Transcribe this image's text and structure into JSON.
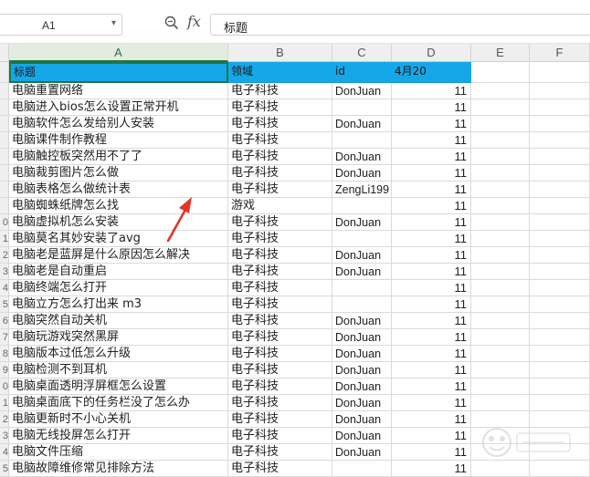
{
  "formula_bar": {
    "cell_ref": "A1",
    "fx": "fx",
    "formula_text": "标题"
  },
  "columns": [
    "A",
    "B",
    "C",
    "D",
    "E",
    "F"
  ],
  "header_row": {
    "title": "标题",
    "field": "领域",
    "id": "id",
    "date": "4月20"
  },
  "rows": [
    {
      "n": "",
      "title": "电脑重置网络",
      "field": "电子科技",
      "id": "DonJuan",
      "count": "11"
    },
    {
      "n": "",
      "title": "电脑进入bios怎么设置正常开机",
      "field": "电子科技",
      "id": "",
      "count": "11"
    },
    {
      "n": "",
      "title": "电脑软件怎么发给别人安装",
      "field": "电子科技",
      "id": "DonJuan",
      "count": "11"
    },
    {
      "n": "",
      "title": "电脑课件制作教程",
      "field": "电子科技",
      "id": "",
      "count": "11"
    },
    {
      "n": "",
      "title": "电脑触控板突然用不了了",
      "field": "电子科技",
      "id": "DonJuan",
      "count": "11"
    },
    {
      "n": "",
      "title": "电脑裁剪图片怎么做",
      "field": "电子科技",
      "id": "DonJuan",
      "count": "11"
    },
    {
      "n": "",
      "title": "电脑表格怎么做统计表",
      "field": "电子科技",
      "id": "ZengLi199",
      "count": "11"
    },
    {
      "n": "",
      "title": "电脑蜘蛛纸牌怎么找",
      "field": "游戏",
      "id": "",
      "count": "11"
    },
    {
      "n": "0",
      "title": "电脑虚拟机怎么安装",
      "field": "电子科技",
      "id": "DonJuan",
      "count": "11"
    },
    {
      "n": "1",
      "title": "电脑莫名其妙安装了avg",
      "field": "电子科技",
      "id": "",
      "count": "11"
    },
    {
      "n": "2",
      "title": "电脑老是蓝屏是什么原因怎么解决",
      "field": "电子科技",
      "id": "DonJuan",
      "count": "11"
    },
    {
      "n": "3",
      "title": "电脑老是自动重启",
      "field": "电子科技",
      "id": "DonJuan",
      "count": "11"
    },
    {
      "n": "4",
      "title": "电脑终端怎么打开",
      "field": "电子科技",
      "id": "",
      "count": "11"
    },
    {
      "n": "5",
      "title": "电脑立方怎么打出来 m3",
      "field": "电子科技",
      "id": "",
      "count": "11"
    },
    {
      "n": "6",
      "title": "电脑突然自动关机",
      "field": "电子科技",
      "id": "DonJuan",
      "count": "11"
    },
    {
      "n": "7",
      "title": "电脑玩游戏突然黑屏",
      "field": "电子科技",
      "id": "DonJuan",
      "count": "11"
    },
    {
      "n": "8",
      "title": "电脑版本过低怎么升级",
      "field": "电子科技",
      "id": "DonJuan",
      "count": "11"
    },
    {
      "n": "9",
      "title": "电脑检测不到耳机",
      "field": "电子科技",
      "id": "DonJuan",
      "count": "11"
    },
    {
      "n": "0",
      "title": "电脑桌面透明浮屏框怎么设置",
      "field": "电子科技",
      "id": "DonJuan",
      "count": "11"
    },
    {
      "n": "1",
      "title": "电脑桌面底下的任务栏没了怎么办",
      "field": "电子科技",
      "id": "DonJuan",
      "count": "11"
    },
    {
      "n": "2",
      "title": "电脑更新时不小心关机",
      "field": "电子科技",
      "id": "DonJuan",
      "count": "11"
    },
    {
      "n": "3",
      "title": "电脑无线投屏怎么打开",
      "field": "电子科技",
      "id": "DonJuan",
      "count": "11"
    },
    {
      "n": "4",
      "title": "电脑文件压缩",
      "field": "电子科技",
      "id": "DonJuan",
      "count": "11"
    },
    {
      "n": "5",
      "title": "电脑故障维修常见排除方法",
      "field": "电子科技",
      "id": "",
      "count": "11"
    }
  ],
  "colors": {
    "header_fill": "#16a7e8",
    "selection": "#217346",
    "arrow": "#e8332a"
  }
}
